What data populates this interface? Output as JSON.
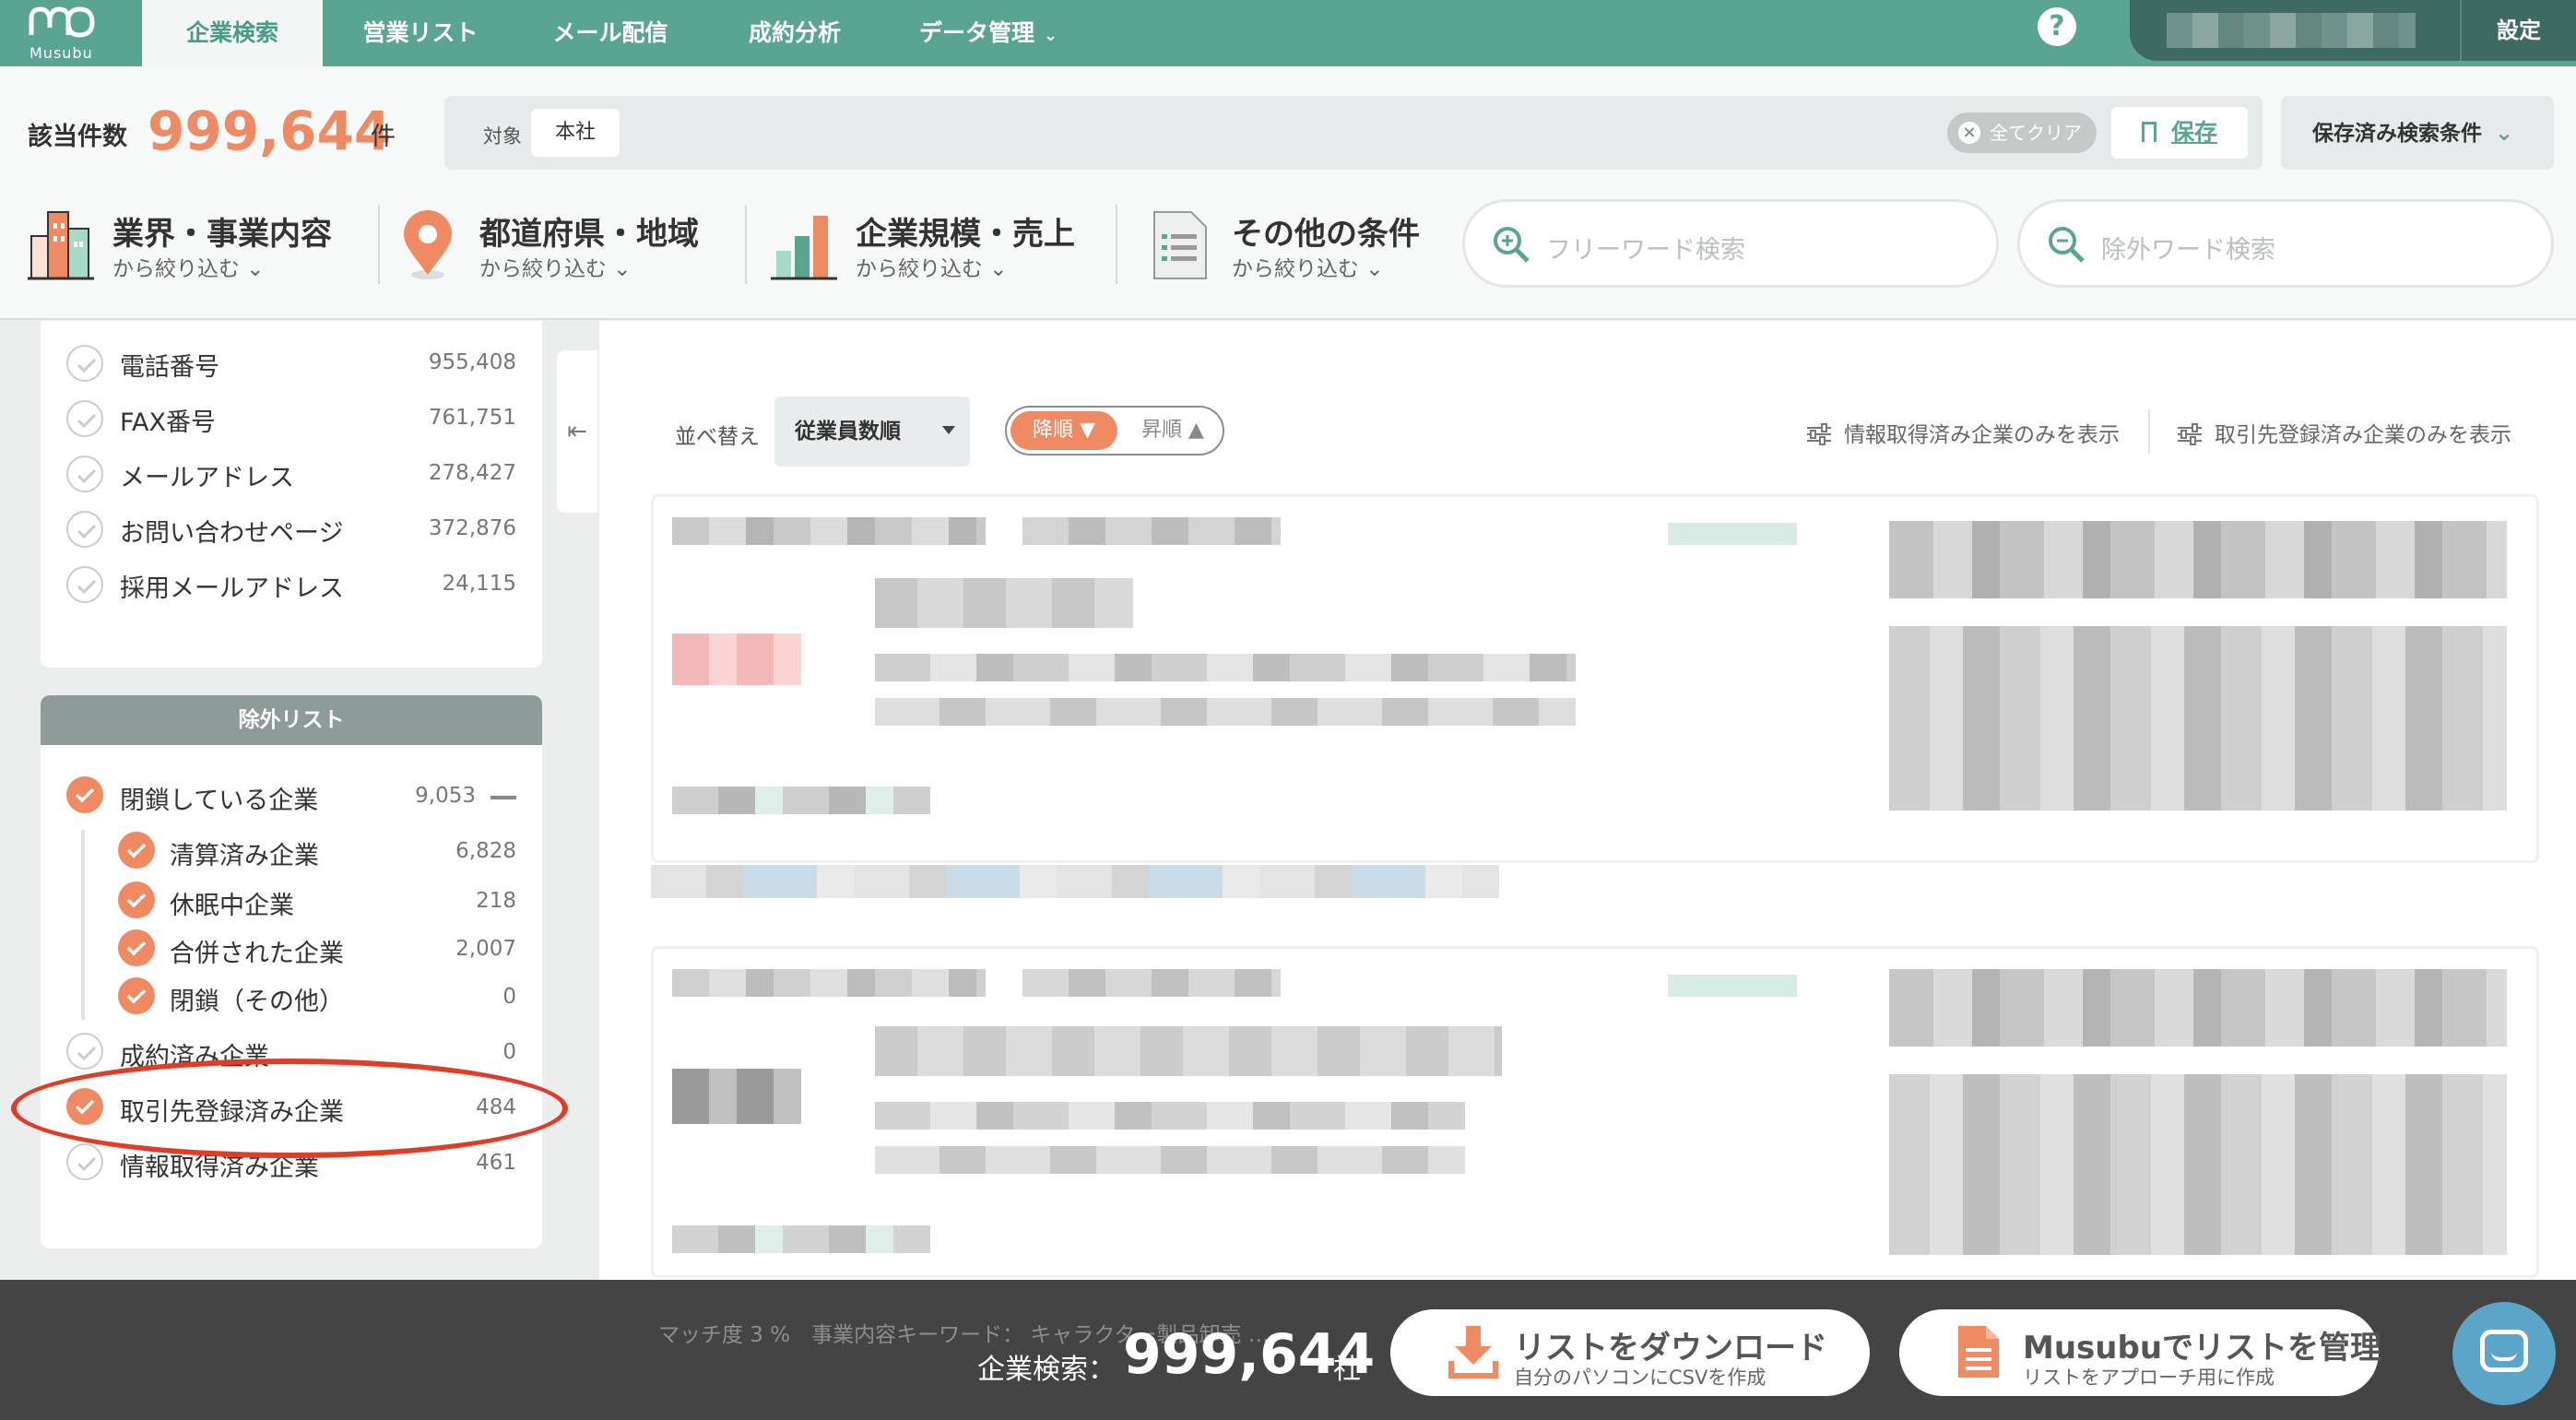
{
  "brand": {
    "name": "Musubu"
  },
  "nav": {
    "tabs": [
      {
        "label": "企業検索"
      },
      {
        "label": "営業リスト"
      },
      {
        "label": "メール配信"
      },
      {
        "label": "成約分析"
      },
      {
        "label": "データ管理"
      }
    ],
    "active_tab": "企業検索",
    "help": "?",
    "settings": "設定"
  },
  "summary": {
    "label": "該当件数",
    "count": "999,644",
    "unit": "件"
  },
  "conditions": {
    "target_label": "対象",
    "target_value": "本社",
    "clear_label": "全てクリア",
    "save_label": "保存",
    "saved_label": "保存済み検索条件"
  },
  "filters": [
    {
      "title": "業界・事業内容",
      "sub": "から絞り込む"
    },
    {
      "title": "都道府県・地域",
      "sub": "から絞り込む"
    },
    {
      "title": "企業規模・売上",
      "sub": "から絞り込む"
    },
    {
      "title": "その他の条件",
      "sub": "から絞り込む"
    }
  ],
  "search": {
    "free_placeholder": "フリーワード検索",
    "exclude_placeholder": "除外ワード検索"
  },
  "contact_filters": [
    {
      "label": "電話番号",
      "count": "955,408",
      "checked": false
    },
    {
      "label": "FAX番号",
      "count": "761,751",
      "checked": false
    },
    {
      "label": "メールアドレス",
      "count": "278,427",
      "checked": false
    },
    {
      "label": "お問い合わせページ",
      "count": "372,876",
      "checked": false
    },
    {
      "label": "採用メールアドレス",
      "count": "24,115",
      "checked": false
    }
  ],
  "exclude": {
    "title": "除外リスト",
    "items": [
      {
        "label": "閉鎖している企業",
        "count": "9,053",
        "checked": true
      },
      {
        "label": "清算済み企業",
        "count": "6,828",
        "checked": true
      },
      {
        "label": "休眠中企業",
        "count": "218",
        "checked": true
      },
      {
        "label": "合併された企業",
        "count": "2,007",
        "checked": true
      },
      {
        "label": "閉鎖（その他）",
        "count": "0",
        "checked": true
      },
      {
        "label": "成約済み企業",
        "count": "0",
        "checked": false
      },
      {
        "label": "取引先登録済み企業",
        "count": "484",
        "checked": true
      },
      {
        "label": "情報取得済み企業",
        "count": "461",
        "checked": false
      }
    ]
  },
  "sort": {
    "label": "並べ替え",
    "selected": "従業員数順",
    "desc": "降順 ▼",
    "asc": "昇順 ▲",
    "show_info_acquired": "情報取得済み企業のみを表示",
    "show_registered": "取引先登録済み企業のみを表示"
  },
  "footer": {
    "peek": "マッチ度 3 %　事業内容キーワード： キャラクター製品卸売 …",
    "label": "企業検索：",
    "count": "999,644",
    "unit": "社",
    "download_title": "リストをダウンロード",
    "download_sub": "自分のパソコンにCSVを作成",
    "manage_title": "Musubuでリストを管理",
    "manage_sub": "リストをアプローチ用に作成"
  },
  "colors": {
    "brand": "#5aa591",
    "accent": "#ef8a62",
    "highlight": "#e03c26"
  }
}
